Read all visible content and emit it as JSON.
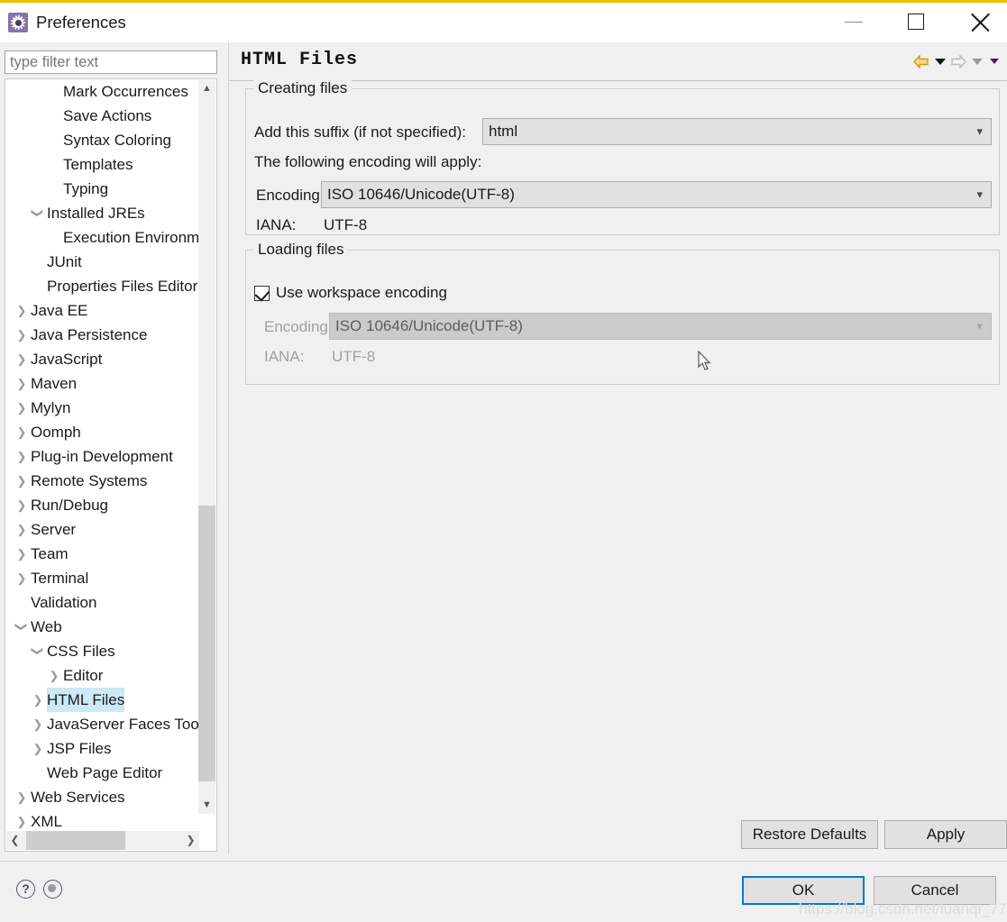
{
  "window": {
    "title": "Preferences",
    "icon": "preferences-gear-icon",
    "accent_top_border": "#e8c200",
    "controls": {
      "minimize": "minimize-icon",
      "maximize": "maximize-icon",
      "close": "close-icon"
    }
  },
  "sidebar": {
    "filter": {
      "value": "",
      "placeholder": "type filter text"
    },
    "selected": "HTML Files",
    "selection_color": "#cde8f6",
    "items": [
      {
        "label": "Mark Occurrences",
        "level": 2,
        "twisty": ""
      },
      {
        "label": "Save Actions",
        "level": 2,
        "twisty": ""
      },
      {
        "label": "Syntax Coloring",
        "level": 2,
        "twisty": ""
      },
      {
        "label": "Templates",
        "level": 2,
        "twisty": ""
      },
      {
        "label": "Typing",
        "level": 2,
        "twisty": ""
      },
      {
        "label": "Installed JREs",
        "level": 1,
        "twisty": "expanded"
      },
      {
        "label": "Execution Environments",
        "level": 2,
        "twisty": ""
      },
      {
        "label": "JUnit",
        "level": 1,
        "twisty": ""
      },
      {
        "label": "Properties Files Editor",
        "level": 1,
        "twisty": ""
      },
      {
        "label": "Java EE",
        "level": 0,
        "twisty": "collapsed"
      },
      {
        "label": "Java Persistence",
        "level": 0,
        "twisty": "collapsed"
      },
      {
        "label": "JavaScript",
        "level": 0,
        "twisty": "collapsed"
      },
      {
        "label": "Maven",
        "level": 0,
        "twisty": "collapsed"
      },
      {
        "label": "Mylyn",
        "level": 0,
        "twisty": "collapsed"
      },
      {
        "label": "Oomph",
        "level": 0,
        "twisty": "collapsed"
      },
      {
        "label": "Plug-in Development",
        "level": 0,
        "twisty": "collapsed"
      },
      {
        "label": "Remote Systems",
        "level": 0,
        "twisty": "collapsed"
      },
      {
        "label": "Run/Debug",
        "level": 0,
        "twisty": "collapsed"
      },
      {
        "label": "Server",
        "level": 0,
        "twisty": "collapsed"
      },
      {
        "label": "Team",
        "level": 0,
        "twisty": "collapsed"
      },
      {
        "label": "Terminal",
        "level": 0,
        "twisty": "collapsed"
      },
      {
        "label": "Validation",
        "level": 0,
        "twisty": ""
      },
      {
        "label": "Web",
        "level": 0,
        "twisty": "expanded"
      },
      {
        "label": "CSS Files",
        "level": 1,
        "twisty": "expanded"
      },
      {
        "label": "Editor",
        "level": 2,
        "twisty": "collapsed"
      },
      {
        "label": "HTML Files",
        "level": 1,
        "twisty": "collapsed",
        "selected": true
      },
      {
        "label": "JavaServer Faces Tools",
        "level": 1,
        "twisty": "collapsed"
      },
      {
        "label": "JSP Files",
        "level": 1,
        "twisty": "collapsed"
      },
      {
        "label": "Web Page Editor",
        "level": 1,
        "twisty": ""
      },
      {
        "label": "Web Services",
        "level": 0,
        "twisty": "collapsed"
      },
      {
        "label": "XML",
        "level": 0,
        "twisty": "collapsed"
      }
    ],
    "scrollbars": {
      "vertical_up": "scroll-up-icon",
      "vertical_down": "scroll-down-icon",
      "horizontal_left": "scroll-left-icon",
      "horizontal_right": "scroll-right-icon"
    }
  },
  "panel": {
    "title": "HTML Files",
    "nav": {
      "back": "back-arrow-icon",
      "back_menu": "back-dropdown-icon",
      "forward": "forward-arrow-icon",
      "forward_menu": "forward-dropdown-icon",
      "view_menu": "view-menu-icon",
      "back_color": "#e8a800",
      "forward_color": "#bdbdbd"
    },
    "creating_files": {
      "legend": "Creating files",
      "suffix_label": "Add this suffix (if not specified):",
      "suffix_value": "html",
      "encoding_note": "The following encoding will apply:",
      "encoding_label": "Encoding:",
      "encoding_value": "ISO 10646/Unicode(UTF-8)",
      "iana_label": "IANA:",
      "iana_value": "UTF-8"
    },
    "loading_files": {
      "legend": "Loading files",
      "use_workspace_encoding_label": "Use workspace encoding",
      "use_workspace_encoding_checked": true,
      "encoding_label": "Encoding:",
      "encoding_value": "ISO 10646/Unicode(UTF-8)",
      "iana_label": "IANA:",
      "iana_value": "UTF-8",
      "disabled": true
    }
  },
  "footer": {
    "restore_defaults": "Restore Defaults",
    "apply": "Apply",
    "ok": "OK",
    "cancel": "Cancel",
    "ok_focus_color": "#0078d7",
    "help_icon": "help-question-icon",
    "info_icon": "info-circle-icon"
  },
  "watermark": "https://blog.csdn.net/luanqi_77"
}
